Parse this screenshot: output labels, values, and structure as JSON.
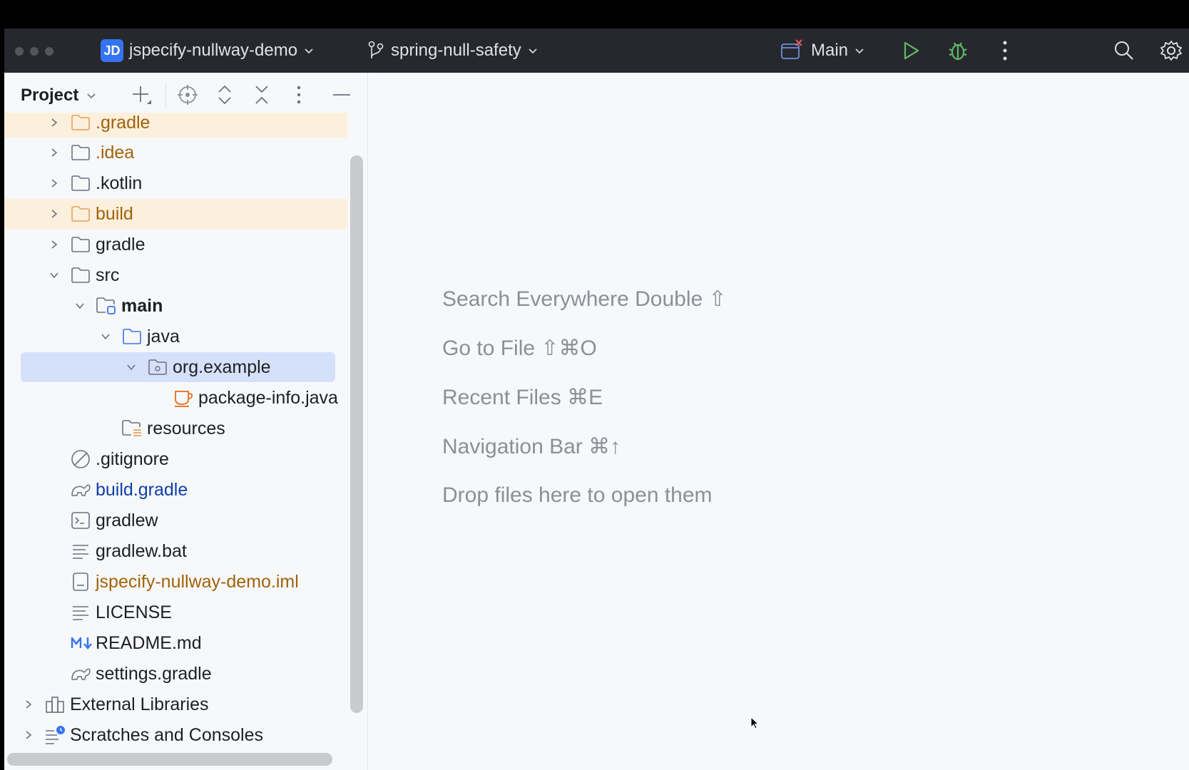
{
  "titlebar": {
    "project_badge": "JD",
    "project_name": "jspecify-nullway-demo",
    "branch": "spring-null-safety",
    "run_config": "Main",
    "icons": [
      "traffic-lights",
      "branch-icon",
      "run-config-icon",
      "run-icon",
      "debug-icon",
      "more-icon",
      "search-icon",
      "settings-icon"
    ],
    "colors": {
      "background": "#27282e",
      "run": "#5fb865",
      "debug": "#5fb865",
      "badge": "#3574f0"
    }
  },
  "project_panel": {
    "title": "Project",
    "toolbar_icons": [
      "add-icon",
      "locate-icon",
      "expand-all-icon",
      "collapse-all-icon",
      "more-icon",
      "minimize-icon"
    ],
    "tree": [
      {
        "label": ".gradle",
        "type": "folder",
        "color": "orange",
        "expanded": false,
        "highlighted": true
      },
      {
        "label": ".idea",
        "type": "folder",
        "color": "orange",
        "expanded": false
      },
      {
        "label": ".kotlin",
        "type": "folder",
        "expanded": false
      },
      {
        "label": "build",
        "type": "folder",
        "color": "orange",
        "expanded": false,
        "highlighted": true
      },
      {
        "label": "gradle",
        "type": "folder",
        "expanded": false
      },
      {
        "label": "src",
        "type": "folder",
        "expanded": true
      },
      {
        "label": "main",
        "type": "module-folder",
        "expanded": true,
        "bold": true
      },
      {
        "label": "java",
        "type": "source-folder",
        "expanded": true
      },
      {
        "label": "org.example",
        "type": "package",
        "expanded": true,
        "selected": true
      },
      {
        "label": "package-info.java",
        "type": "java-file"
      },
      {
        "label": "resources",
        "type": "resources-folder"
      },
      {
        "label": ".gitignore",
        "type": "ignore-file"
      },
      {
        "label": "build.gradle",
        "type": "gradle-file",
        "color": "blue"
      },
      {
        "label": "gradlew",
        "type": "shell-file"
      },
      {
        "label": "gradlew.bat",
        "type": "text-file"
      },
      {
        "label": "jspecify-nullway-demo.iml",
        "type": "iml-file",
        "color": "orange"
      },
      {
        "label": "LICENSE",
        "type": "text-file"
      },
      {
        "label": "README.md",
        "type": "markdown-file"
      },
      {
        "label": "settings.gradle",
        "type": "gradle-file"
      },
      {
        "label": "External Libraries",
        "type": "libraries",
        "expanded": false
      },
      {
        "label": "Scratches and Consoles",
        "type": "scratches",
        "expanded": false
      }
    ]
  },
  "editor": {
    "hints": [
      "Search Everywhere Double ⇧",
      "Go to File ⇧⌘O",
      "Recent Files ⌘E",
      "Navigation Bar ⌘↑",
      "Drop files here to open them"
    ]
  }
}
